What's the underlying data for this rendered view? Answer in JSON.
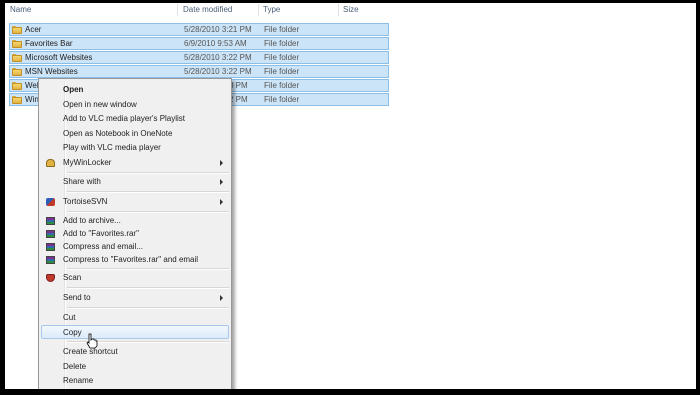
{
  "columns": {
    "name": "Name",
    "date": "Date modified",
    "type": "Type",
    "size": "Size"
  },
  "rows": [
    {
      "name": "Acer",
      "date": "5/28/2010 3:21 PM",
      "type": "File folder"
    },
    {
      "name": "Favorites Bar",
      "date": "6/9/2010 9:53 AM",
      "type": "File folder"
    },
    {
      "name": "Microsoft Websites",
      "date": "5/28/2010 3:22 PM",
      "type": "File folder"
    },
    {
      "name": "MSN Websites",
      "date": "5/28/2010 3:22 PM",
      "type": "File folder"
    },
    {
      "name": "Web",
      "date": "8 PM",
      "type": "File folder"
    },
    {
      "name": "Win",
      "date": "2 PM",
      "type": "File folder"
    }
  ],
  "menu": {
    "open": "Open",
    "open_new_window": "Open in new window",
    "add_vlc_playlist": "Add to VLC media player's Playlist",
    "open_onenote": "Open as Notebook in OneNote",
    "play_vlc": "Play with VLC media player",
    "mywinlocker": "MyWinLocker",
    "share_with": "Share with",
    "tortoisesvn": "TortoiseSVN",
    "add_archive": "Add to archive...",
    "add_favorites_rar": "Add to \"Favorites.rar\"",
    "compress_email": "Compress and email...",
    "compress_favorites_email": "Compress to \"Favorites.rar\" and email",
    "scan": "Scan",
    "send_to": "Send to",
    "cut": "Cut",
    "copy": "Copy",
    "create_shortcut": "Create shortcut",
    "delete": "Delete",
    "rename": "Rename"
  },
  "colors": {
    "selection": "#cce4f7",
    "menu_bg": "#f0f0f0",
    "frame": "#000000"
  }
}
